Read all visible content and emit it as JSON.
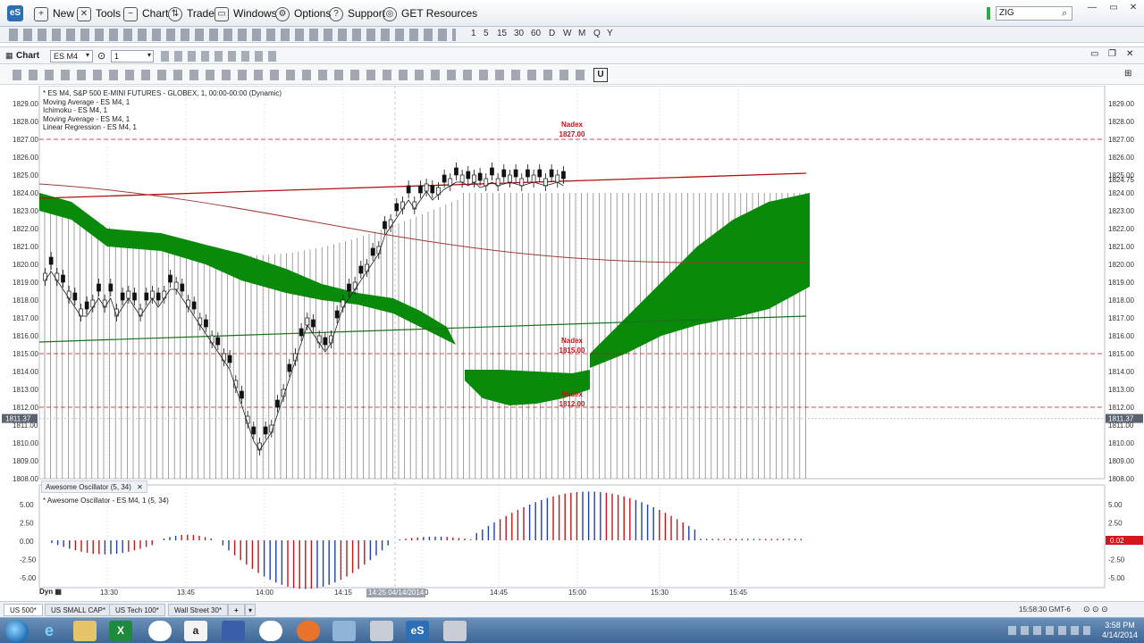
{
  "menubar": {
    "logo": "eS",
    "items": [
      "New",
      "Tools",
      "Chart",
      "Trade",
      "Windows",
      "Options",
      "Support",
      "GET Resources"
    ],
    "search_value": "ZIG"
  },
  "toolbar1": {
    "periods": [
      "1",
      "5",
      "15",
      "30",
      "60",
      "D",
      "W",
      "M",
      "Q",
      "Y"
    ]
  },
  "chart_header": {
    "title": "Chart",
    "instrument": "ES M4",
    "interval": "1"
  },
  "study_legend": [
    "* ES M4, S&P 500 E-MINI FUTURES - GLOBEX, 1, 00:00-00:00 (Dynamic)",
    "Moving Average - ES M4, 1",
    "Ichimoku - ES M4, 1",
    "Moving Average - ES M4, 1",
    "Linear Regression - ES M4, 1"
  ],
  "price_axis": {
    "labels": [
      "1829.00",
      "1828.00",
      "1827.00",
      "1826.00",
      "1825.00",
      "1824.00",
      "1823.00",
      "1822.00",
      "1821.00",
      "1820.00",
      "1819.00",
      "1818.00",
      "1817.00",
      "1816.00",
      "1815.00",
      "1814.00",
      "1813.00",
      "1812.00",
      "1811.00",
      "1810.00",
      "1809.00",
      "1808.00"
    ],
    "current_price": "1811.37",
    "right_price": "1824.75"
  },
  "nadex_levels": [
    {
      "title": "Nadex",
      "price": "1827.00"
    },
    {
      "title": "Nadex",
      "price": "1815.00"
    },
    {
      "title": "Nadex",
      "price": "1812.00"
    }
  ],
  "oscillator": {
    "tab_label": "Awesome Oscillator (5, 34)",
    "legend": "* Awesome Oscillator - ES M4, 1 (5, 34)",
    "axis_labels": [
      "5.00",
      "2.50",
      "0.00",
      "-2.50",
      "-5.00"
    ],
    "current_value": "0.02"
  },
  "time_axis": {
    "dyn_label": "Dyn",
    "labels": [
      "13:30",
      "13:45",
      "14:00",
      "14:15",
      "30",
      "14:45",
      "15:00",
      "15:30",
      "15:45"
    ],
    "cursor_time": "14:25 04/14/2014"
  },
  "tabs": [
    "US 500*",
    "US SMALL CAP*",
    "US Tech 100*",
    "Wall Street 30*"
  ],
  "status": {
    "time": "15:58:30 GMT-6"
  },
  "taskbar": {
    "clock_time": "3:58 PM",
    "clock_date": "4/14/2014",
    "app_label": "eS"
  },
  "colors": {
    "cloud_green": "#0a8a0a",
    "nadex_red": "#c0161c",
    "osc_up": "#1f3fb0",
    "osc_down": "#c0161c",
    "regression": "#b01010",
    "ma_slow": "#a33a3a",
    "ma_green": "#1c6e1c"
  }
}
